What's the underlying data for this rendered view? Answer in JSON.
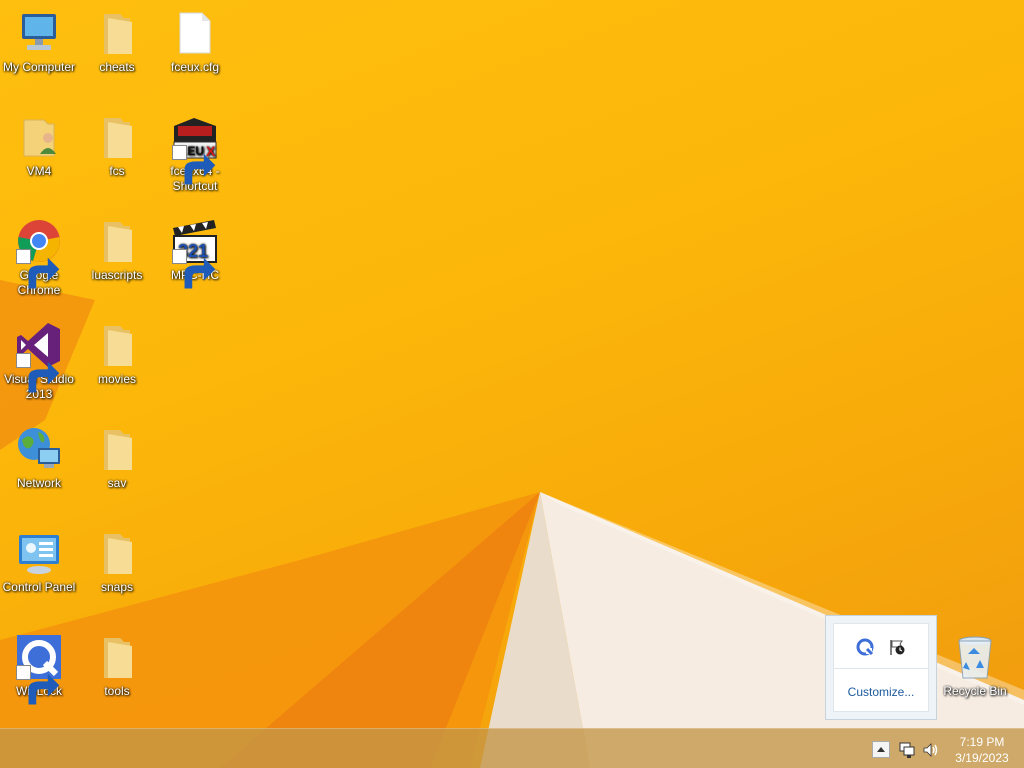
{
  "desktop": {
    "icons_col1": [
      {
        "label": "My Computer",
        "icon": "computer-icon"
      },
      {
        "label": "VM4",
        "icon": "user-folder-icon"
      },
      {
        "label": "Google Chrome",
        "icon": "chrome-icon",
        "shortcut": true
      },
      {
        "label": "Visual Studio 2013",
        "icon": "visual-studio-icon",
        "shortcut": true
      },
      {
        "label": "Network",
        "icon": "network-icon"
      },
      {
        "label": "Control Panel",
        "icon": "control-panel-icon"
      },
      {
        "label": "WinLock",
        "icon": "winlock-icon",
        "shortcut": true
      }
    ],
    "icons_col2": [
      {
        "label": "cheats",
        "icon": "folder-icon"
      },
      {
        "label": "fcs",
        "icon": "folder-icon"
      },
      {
        "label": "luascripts",
        "icon": "folder-icon"
      },
      {
        "label": "movies",
        "icon": "folder-icon"
      },
      {
        "label": "sav",
        "icon": "folder-icon"
      },
      {
        "label": "snaps",
        "icon": "folder-icon"
      },
      {
        "label": "tools",
        "icon": "folder-icon"
      }
    ],
    "icons_col3": [
      {
        "label": "fceux.cfg",
        "icon": "file-icon"
      },
      {
        "label": "fceux64 - Shortcut",
        "icon": "fceux-icon",
        "shortcut": true
      },
      {
        "label": "MPC-HC",
        "icon": "mpc-hc-icon",
        "shortcut": true
      }
    ],
    "recycle_bin": {
      "label": "Recycle Bin",
      "icon": "recycle-bin-icon"
    }
  },
  "tray_overflow": {
    "customize_label": "Customize...",
    "icons": [
      "app-tray-icon",
      "action-center-flag-icon"
    ]
  },
  "taskbar": {
    "expander_icon": "chevron-up-icon",
    "tray_icons": [
      "network-tray-icon",
      "volume-icon"
    ],
    "clock": {
      "time": "7:19 PM",
      "date": "3/19/2023"
    }
  },
  "colors": {
    "wallpaper_primary": "#fcb70a",
    "wallpaper_shadow": "#f08a10",
    "wallpaper_light": "#f6ece1",
    "folder_yellow": "#f3d27a",
    "link_blue": "#1c5a9e"
  }
}
